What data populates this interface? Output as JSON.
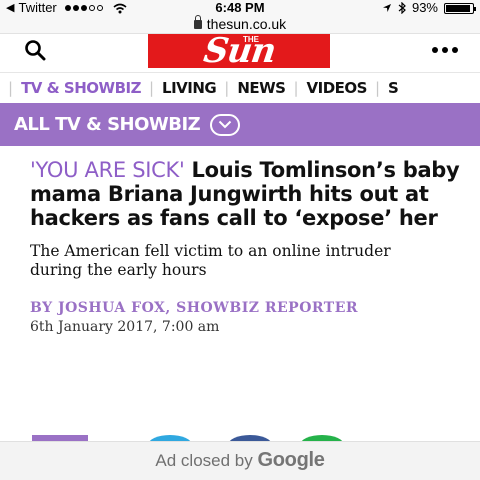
{
  "status_bar": {
    "back_label": "Twitter",
    "time": "6:48 PM",
    "battery_percent": "93%",
    "battery_level": 0.93,
    "icons": [
      "back-arrow-icon",
      "signal-dots-icon",
      "wifi-icon",
      "location-arrow-icon",
      "bluetooth-icon",
      "battery-icon"
    ]
  },
  "browser": {
    "url": "thesun.co.uk",
    "lock_icon": "lock-icon"
  },
  "header": {
    "logo_text": "Sun",
    "logo_small": "THE",
    "logo_color": "#e3191b",
    "search_icon": "search-icon",
    "menu_icon": "more-dots-icon"
  },
  "nav": {
    "items": [
      {
        "label": "TV & SHOWBIZ",
        "active": true
      },
      {
        "label": "LIVING",
        "active": false
      },
      {
        "label": "NEWS",
        "active": false
      },
      {
        "label": "VIDEOS",
        "active": false
      },
      {
        "label": "S",
        "active": false
      }
    ],
    "active_color": "#8e5ec7"
  },
  "section": {
    "title": "ALL TV & SHOWBIZ",
    "toggle_icon": "chevron-down-circle-icon",
    "bar_color": "#9a71c5"
  },
  "article": {
    "kicker": "'YOU ARE SICK'",
    "headline": "Louis Tomlinson’s baby mama Briana Jungwirth hits out at hackers as fans call to ‘expose’ her",
    "standfirst": "The American fell victim to an online intruder during the early hours",
    "byline": "BY JOSHUA FOX, SHOWBIZ REPORTER",
    "date": "6th January 2017, 7:00 am"
  },
  "share": {
    "buttons": [
      "share-button",
      "twitter-icon",
      "facebook-icon",
      "whatsapp-icon"
    ]
  },
  "ad": {
    "text": "Ad closed by",
    "brand": "Google"
  }
}
